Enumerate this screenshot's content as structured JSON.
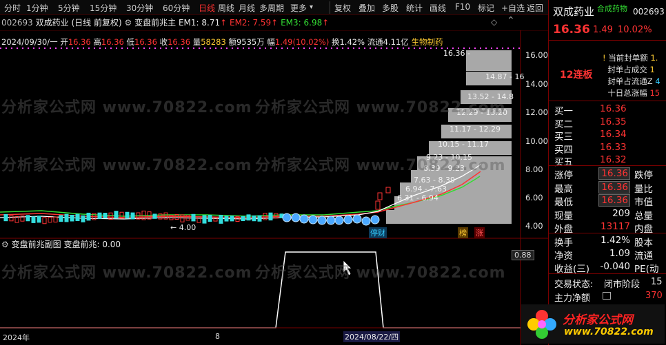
{
  "toolbar": {
    "items": [
      "分时",
      "1分钟",
      "5分钟",
      "15分钟",
      "30分钟",
      "60分钟",
      "日线",
      "周线",
      "月线",
      "多周期",
      "更多"
    ],
    "more_arrow": "▾",
    "right_items": [
      "复权",
      "叠加",
      "多股",
      "统计",
      "画线",
      "F10",
      "标记",
      "+自选",
      "返回"
    ]
  },
  "chart_header": {
    "code": "002693",
    "name": "双成药业",
    "period": "(日线 前复权)",
    "indicator": "变盘前兆主",
    "em1_label": "EM1:",
    "em1_value": "8.71",
    "em2_label": "EM2:",
    "em2_value": "7.59",
    "em3_label": "EM3:",
    "em3_value": "6.98",
    "up_arrow": "↑"
  },
  "info_line": {
    "date": "2024/09/30/一",
    "open_label": "开",
    "open": "16.36",
    "high_label": "高",
    "high": "16.36",
    "low_label": "低",
    "low": "16.36",
    "close_label": "收",
    "close": "16.36",
    "vol_label": "量",
    "vol": "58283",
    "amt_label": "额",
    "amt": "9535万",
    "chg_label": "幅",
    "chg": "1.49(10.02%)",
    "turnover": "换1.42%",
    "float": "流通4.11亿",
    "sector": "生物制药"
  },
  "price_axis": [
    "16.00",
    "14.00",
    "12.00",
    "10.00",
    "8.00",
    "6.00",
    "4.00"
  ],
  "chip_labels": [
    "16.36 -",
    "14.87 - 16",
    "13.52 - 14.8",
    "12.29 - 13.20",
    "11.17 - 12.29",
    "10.15 - 11.17",
    "9.23 - 10.15",
    "8.39 - 9.23",
    "7.63 - 8.39",
    "6.94 - 7.63",
    "6.31 - 6.94"
  ],
  "low_marker": "← 4.00",
  "markers": {
    "tingcai": "停财",
    "bang": "榜",
    "zhang": "涨"
  },
  "sub_header": {
    "name": "变盘前兆副图",
    "label": "变盘前兆:",
    "value": "0.00"
  },
  "sub_axis_value": "0.88",
  "bottom_axis": {
    "left": "2024年",
    "mid": "8",
    "cursor_date": "2024/08/22/四"
  },
  "watermark": "分析家公式网 www.70822.com",
  "right_panel": {
    "name": "双成药业",
    "tag": "合成药物",
    "code": "002693",
    "price": "16.36",
    "chg": "1.49",
    "pct": "10.02%",
    "limit_up_streak": "12连板",
    "seal_lines": [
      "当前封单额",
      "封单占成交",
      "封单占流通Z",
      "十日总涨幅"
    ],
    "seal_values": [
      "1.",
      "1",
      "4",
      "15"
    ],
    "bids": [
      {
        "label": "买一",
        "price": "16.36",
        "vol": "",
        "vol_color": "#ffcc33"
      },
      {
        "label": "买二",
        "price": "16.35",
        "vol": ""
      },
      {
        "label": "买三",
        "price": "16.34",
        "vol": ""
      },
      {
        "label": "买四",
        "price": "16.33",
        "vol": ""
      },
      {
        "label": "买五",
        "price": "16.32",
        "vol": ""
      }
    ],
    "stats": [
      {
        "l": "涨停",
        "v": "16.36",
        "r": "跌停"
      },
      {
        "l": "最高",
        "v": "16.36",
        "r": "量比"
      },
      {
        "l": "最低",
        "v": "16.36",
        "r": "市值"
      },
      {
        "l": "现量",
        "v": "209",
        "r": "总量"
      },
      {
        "l": "外盘",
        "v": "13117",
        "r": "内盘"
      }
    ],
    "stats2": [
      {
        "l": "换手",
        "v": "1.42%",
        "r": "股本"
      },
      {
        "l": "净资",
        "v": "1.09",
        "r": "流通"
      },
      {
        "l": "收益(三)",
        "v": "-0.040",
        "r": "PE(动"
      }
    ],
    "trade_state_label": "交易状态:",
    "trade_state_value": "闭市阶段",
    "trade_state_tail": "15",
    "main_net_label": "主力净额",
    "main_net_value": "370"
  },
  "logo": {
    "text": "分析家公式网",
    "url": "www.70822.com"
  },
  "colors": {
    "up": "#ff3333",
    "down": "#33dddd",
    "bg": "#000000",
    "chip": "#a8a8a8",
    "border": "#7a0000"
  }
}
